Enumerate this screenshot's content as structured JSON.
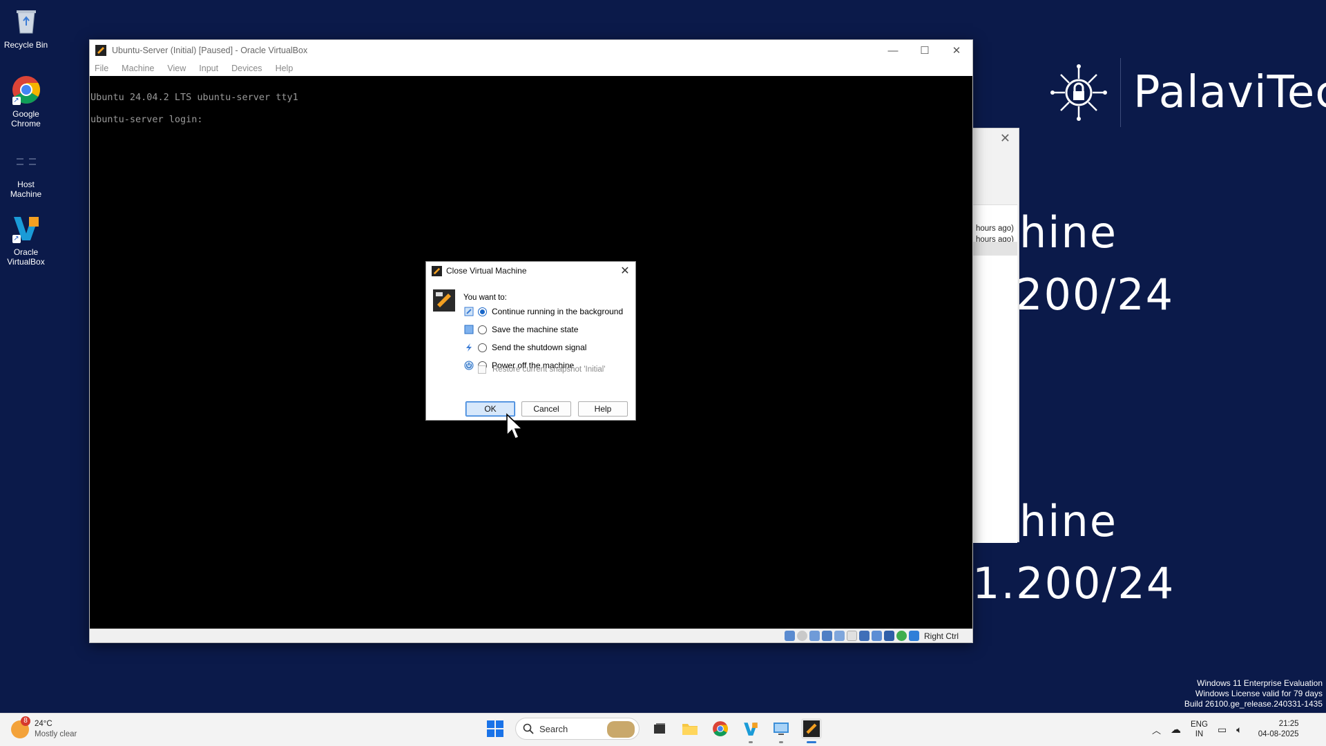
{
  "desktop": {
    "icons": [
      {
        "label": "Recycle Bin"
      },
      {
        "label": "Google Chrome"
      },
      {
        "label": "Host Machine"
      },
      {
        "label": "Oracle VirtualBox"
      }
    ]
  },
  "wallpaper": {
    "brand": "PalaviTech",
    "line1": "hine",
    "line2": "200/24",
    "line3": "hine",
    "line4": "1.200/24",
    "watermark": [
      "Windows 11 Enterprise Evaluation",
      "Windows License valid for 79 days",
      "Build 26100.ge_release.240331-1435"
    ]
  },
  "background_window": {
    "rows": [
      "hours ago)",
      "hours ago)"
    ]
  },
  "vbox": {
    "title": "Ubuntu-Server (Initial) [Paused] - Oracle VirtualBox",
    "menu": [
      "File",
      "Machine",
      "View",
      "Input",
      "Devices",
      "Help"
    ],
    "console": [
      "Ubuntu 24.04.2 LTS ubuntu-server tty1",
      "ubuntu-server login:"
    ],
    "host_key": "Right Ctrl"
  },
  "dialog": {
    "title": "Close Virtual Machine",
    "prompt": "You want to:",
    "options": [
      {
        "label": "Continue running in the background",
        "selected": true
      },
      {
        "label": "Save the machine state",
        "selected": false
      },
      {
        "label": "Send the shutdown signal",
        "selected": false
      },
      {
        "label": "Power off the machine",
        "selected": false
      }
    ],
    "restore_label": "Restore current snapshot 'Initial'",
    "ok_label": "OK",
    "cancel_label": "Cancel",
    "help_label": "Help"
  },
  "taskbar": {
    "weather": {
      "badge": "8",
      "temp": "24°C",
      "condition": "Mostly clear"
    },
    "search_placeholder": "Search",
    "language": [
      "ENG",
      "IN"
    ],
    "time": "21:25",
    "date": "04-08-2025"
  },
  "colors": {
    "accent": "#1866c8",
    "desktop_bg": "#0b1a4a"
  }
}
